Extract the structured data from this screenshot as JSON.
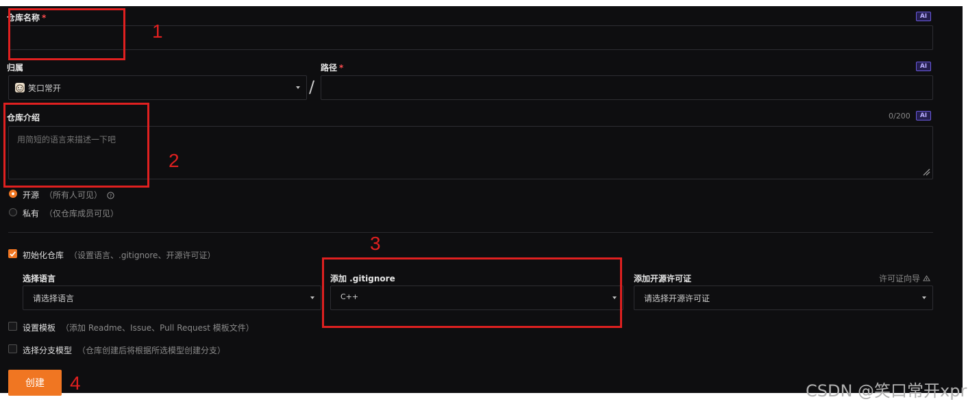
{
  "form": {
    "repo_name": {
      "label": "仓库名称",
      "required": "*",
      "ai_badge": "AI",
      "value": ""
    },
    "owner": {
      "label": "归属",
      "value": "笑口常开"
    },
    "path_separator": "/",
    "path": {
      "label": "路径",
      "required": "*",
      "ai_badge": "AI",
      "value": ""
    },
    "description": {
      "label": "仓库介绍",
      "counter": "0/200",
      "ai_badge": "AI",
      "placeholder": "用简短的语言来描述一下吧"
    },
    "visibility": {
      "open": {
        "label": "开源",
        "hint": "（所有人可见）",
        "selected": true
      },
      "private": {
        "label": "私有",
        "hint": "（仅仓库成员可见）",
        "selected": false
      }
    },
    "init_repo": {
      "label": "初始化仓库",
      "hint": "（设置语言、.gitignore、开源许可证）",
      "checked": true
    },
    "language": {
      "label": "选择语言",
      "value": "请选择语言"
    },
    "gitignore": {
      "label": "添加 .gitignore",
      "value": "C++"
    },
    "license": {
      "label": "添加开源许可证",
      "guide": "许可证向导",
      "value": "请选择开源许可证"
    },
    "template": {
      "label": "设置模板",
      "hint": "（添加 Readme、Issue、Pull Request 模板文件）",
      "checked": false
    },
    "branch_model": {
      "label": "选择分支模型",
      "hint": "（仓库创建后将根据所选模型创建分支）",
      "checked": false
    },
    "create_button": "创建"
  },
  "annotations": [
    "1",
    "2",
    "3",
    "4"
  ],
  "watermark": "CSDN @笑口常开xpr",
  "colors": {
    "accent": "#f07622",
    "annotation": "#e02020",
    "background": "#0e0e10"
  }
}
